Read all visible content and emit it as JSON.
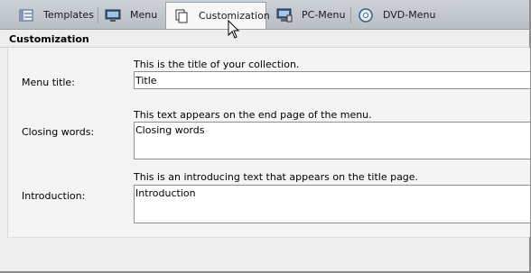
{
  "tabs": [
    {
      "label": "Templates",
      "icon": "templates-icon"
    },
    {
      "label": "Menu",
      "icon": "monitor-icon"
    },
    {
      "label": "Customization",
      "icon": "document-copy-icon",
      "active": true
    },
    {
      "label": "PC-Menu",
      "icon": "pc-monitor-icon"
    },
    {
      "label": "DVD-Menu",
      "icon": "dvd-disc-icon"
    }
  ],
  "section": {
    "title": "Customization"
  },
  "fields": {
    "menu_title": {
      "label": "Menu title:",
      "hint": "This is the title of your collection.",
      "value": "Title"
    },
    "closing_words": {
      "label": "Closing words:",
      "hint": "This text appears on the end page of the menu.",
      "value": "Closing words"
    },
    "introduction": {
      "label": "Introduction:",
      "hint": "This is an introducing text that appears on the title page.",
      "value": "Introduction"
    }
  },
  "colors": {
    "tabbar": "#c3c8ce",
    "panel": "#f4f4f4",
    "field_border": "#8e8f8f"
  }
}
